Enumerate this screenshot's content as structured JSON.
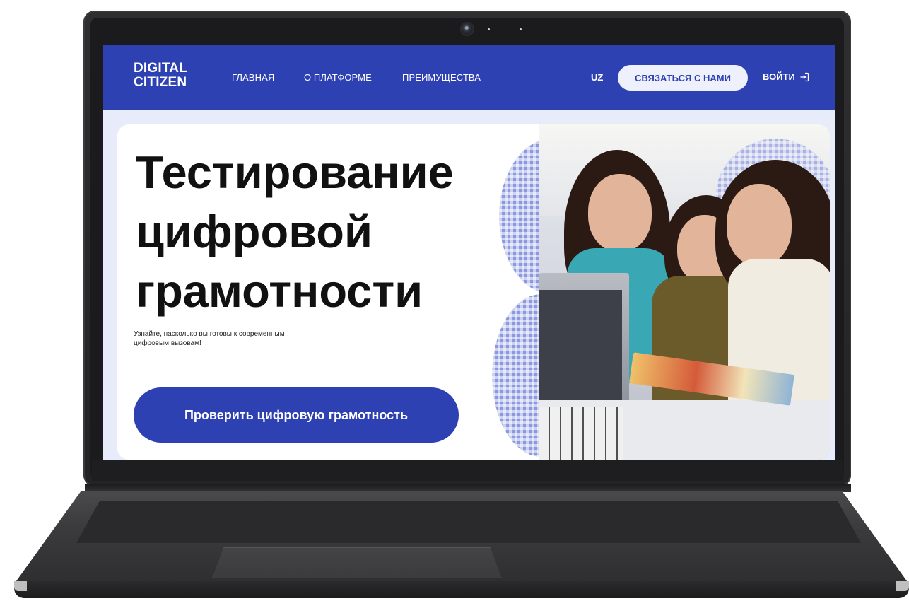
{
  "site": {
    "logo_line1": "DIGITAL",
    "logo_line2": "CITIZEN"
  },
  "nav": {
    "items": [
      {
        "label": "ГЛАВНАЯ"
      },
      {
        "label": "О ПЛАТФОРМЕ"
      },
      {
        "label": "ПРЕИМУЩЕСТВА"
      }
    ],
    "language": "UZ",
    "contact_label": "СВЯЗАТЬСЯ С НАМИ",
    "login_label": "ВОЙТИ"
  },
  "hero": {
    "title_lines": [
      "Тестирование",
      "цифровой",
      "грамотности"
    ],
    "subtitle_lines": [
      "Узнайте, насколько вы готовы к современным",
      "цифровым вызовам!"
    ],
    "cta_label": "Проверить цифровую грамотность"
  },
  "colors": {
    "brand_blue": "#2e41b3",
    "accent_light": "#8c98df",
    "page_bg": "#e8ecfa",
    "laptop_body": "#2a2a2c"
  },
  "icons": {
    "login": "login-arrow-icon",
    "camera": "webcam-icon"
  }
}
